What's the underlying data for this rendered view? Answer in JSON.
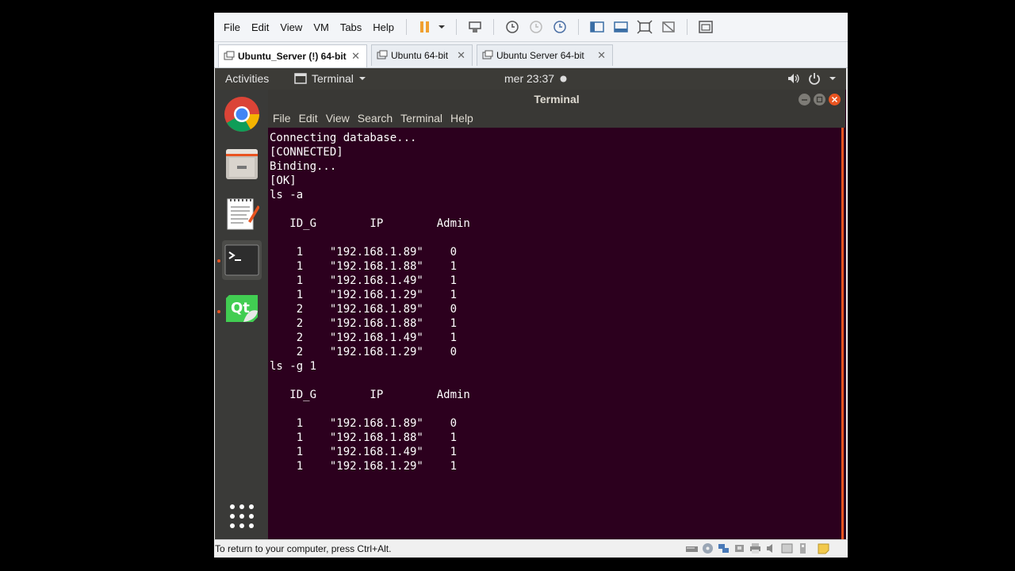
{
  "vm_menu": [
    "File",
    "Edit",
    "View",
    "VM",
    "Tabs",
    "Help"
  ],
  "vm_tabs": [
    {
      "label": "Ubuntu_Server (!) 64-bit",
      "active": true
    },
    {
      "label": "Ubuntu 64-bit",
      "active": false
    },
    {
      "label": "Ubuntu Server 64-bit",
      "active": false
    }
  ],
  "tab_close_glyph": "✕",
  "topbar": {
    "activities": "Activities",
    "app_name": "Terminal",
    "clock": "mer 23:37"
  },
  "dock": [
    "chrome-icon",
    "files-icon",
    "text-editor-icon",
    "terminal-icon",
    "qt-creator-icon",
    "show-apps-icon"
  ],
  "terminal": {
    "title": "Terminal",
    "menu": [
      "File",
      "Edit",
      "View",
      "Search",
      "Terminal",
      "Help"
    ],
    "output": "Connecting database...\n[CONNECTED]\nBinding...\n[OK]\nls -a\n\n   ID_G        IP        Admin\n\n    1    \"192.168.1.89\"    0\n    1    \"192.168.1.88\"    1\n    1    \"192.168.1.49\"    1\n    1    \"192.168.1.29\"    1\n    2    \"192.168.1.89\"    0\n    2    \"192.168.1.88\"    1\n    2    \"192.168.1.49\"    1\n    2    \"192.168.1.29\"    0\nls -g 1\n\n   ID_G        IP        Admin\n\n    1    \"192.168.1.89\"    0\n    1    \"192.168.1.88\"    1\n    1    \"192.168.1.49\"    1\n    1    \"192.168.1.29\"    1"
  },
  "statusbar": {
    "message": "To return to your computer, press Ctrl+Alt."
  },
  "colors": {
    "terminal_bg": "#2c001e",
    "ubuntu_orange": "#e95420",
    "topbar_bg": "#3c3b37"
  }
}
